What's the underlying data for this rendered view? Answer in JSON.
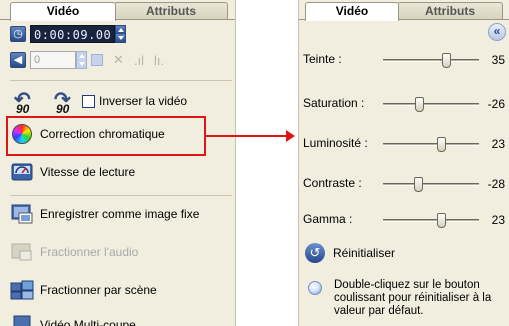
{
  "left_panel": {
    "tabs": [
      "Vidéo",
      "Attributs"
    ],
    "timecode": "0:00:09.00",
    "volume_value": "0",
    "rotate_left_label": "90",
    "rotate_right_label": "90",
    "reverse_video_label": "Inverser la vidéo",
    "actions": {
      "color_correction": "Correction chromatique",
      "playback_speed": "Vitesse de lecture",
      "save_still": "Enregistrer comme image fixe",
      "split_audio": "Fractionner l'audio",
      "split_scene": "Fractionner par scène",
      "multi_trim": "Vidéo Multi-coupe"
    }
  },
  "right_panel": {
    "tabs": [
      "Vidéo",
      "Attributs"
    ],
    "collapse_glyph": "«",
    "sliders": [
      {
        "label": "Teinte :",
        "value": "35",
        "level": 0.675
      },
      {
        "label": "Saturation :",
        "value": "-26",
        "level": 0.37
      },
      {
        "label": "Luminosité :",
        "value": "23",
        "level": 0.615
      },
      {
        "label": "Contraste :",
        "value": "-28",
        "level": 0.36
      },
      {
        "label": "Gamma :",
        "value": "23",
        "level": 0.615
      }
    ],
    "reset_label": "Réinitialiser",
    "tip": "Double-cliquez sur le bouton coulissant pour réinitialiser à la valeur par défaut."
  },
  "colors": {
    "highlight": "#e01616",
    "panel_bg": "#f1eee0",
    "accent_blue": "#264b86"
  }
}
